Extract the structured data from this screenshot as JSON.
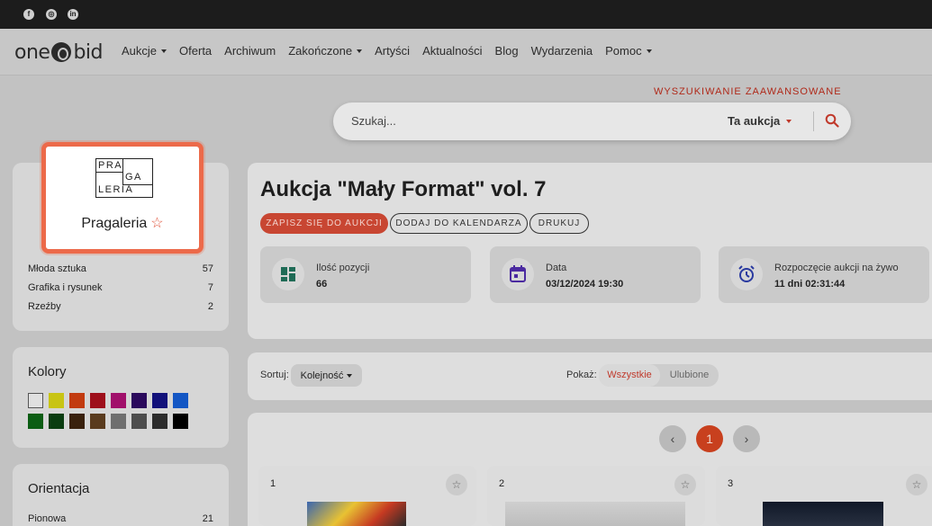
{
  "social": {
    "icons": [
      "facebook-icon",
      "instagram-icon",
      "linkedin-icon"
    ],
    "glyphs": [
      "f",
      "◎",
      "in"
    ]
  },
  "nav": {
    "logo_left": "one",
    "logo_right": "bid",
    "items": [
      "Aukcje",
      "Oferta",
      "Archiwum",
      "Zakończone",
      "Artyści",
      "Aktualności",
      "Blog",
      "Wydarzenia",
      "Pomoc"
    ]
  },
  "search": {
    "advanced": "WYSZUKIWANIE ZAAWANSOWANE",
    "placeholder": "Szukaj...",
    "scope": "Ta aukcja"
  },
  "seller": {
    "logo_lines": [
      "PRA",
      "GA",
      "LERIA"
    ],
    "name": "Pragaleria",
    "star": "☆"
  },
  "categories": [
    {
      "label": "Młoda sztuka",
      "count": "57"
    },
    {
      "label": "Grafika i rysunek",
      "count": "7"
    },
    {
      "label": "Rzeźby",
      "count": "2"
    }
  ],
  "colors_section": {
    "title": "Kolory",
    "swatches": [
      "#e0e0e0",
      "#c8c414",
      "#c23b10",
      "#9e0f1b",
      "#a1106b",
      "#2b0a5c",
      "#12117a",
      "#1457c4",
      "#0b5d13",
      "#0a3d10",
      "#3a210d",
      "#5a3b1e",
      "#6f6f6f",
      "#4d4d4d",
      "#2c2c2c",
      "#000000"
    ]
  },
  "orientation": {
    "title": "Orientacja",
    "items": [
      {
        "label": "Pionowa",
        "count": "21"
      }
    ]
  },
  "auction": {
    "title": "Aukcja \"Mały Format\" vol. 7",
    "buttons": [
      "ZAPISZ SIĘ DO AUKCJI",
      "DODAJ DO KALENDARZA",
      "DRUKUJ"
    ],
    "info": [
      {
        "label": "Ilość pozycji",
        "value": "66",
        "icon": "grid-icon"
      },
      {
        "label": "Data",
        "value": "03/12/2024 19:30",
        "icon": "calendar-icon"
      },
      {
        "label": "Rozpoczęcie aukcji na żywo",
        "value": "11 dni 02:31:44",
        "icon": "alarm-clock-icon"
      }
    ]
  },
  "controls": {
    "sort_label": "Sortuj:",
    "sort_value": "Kolejność",
    "show_label": "Pokaż:",
    "show_all": "Wszystkie",
    "show_fav": "Ulubione"
  },
  "pager": {
    "prev": "‹",
    "current": "1",
    "next": "›"
  },
  "lots": [
    {
      "number": "1",
      "star": "☆"
    },
    {
      "number": "2",
      "star": "☆"
    },
    {
      "number": "3",
      "star": "☆"
    }
  ],
  "accent": "#c8401e"
}
